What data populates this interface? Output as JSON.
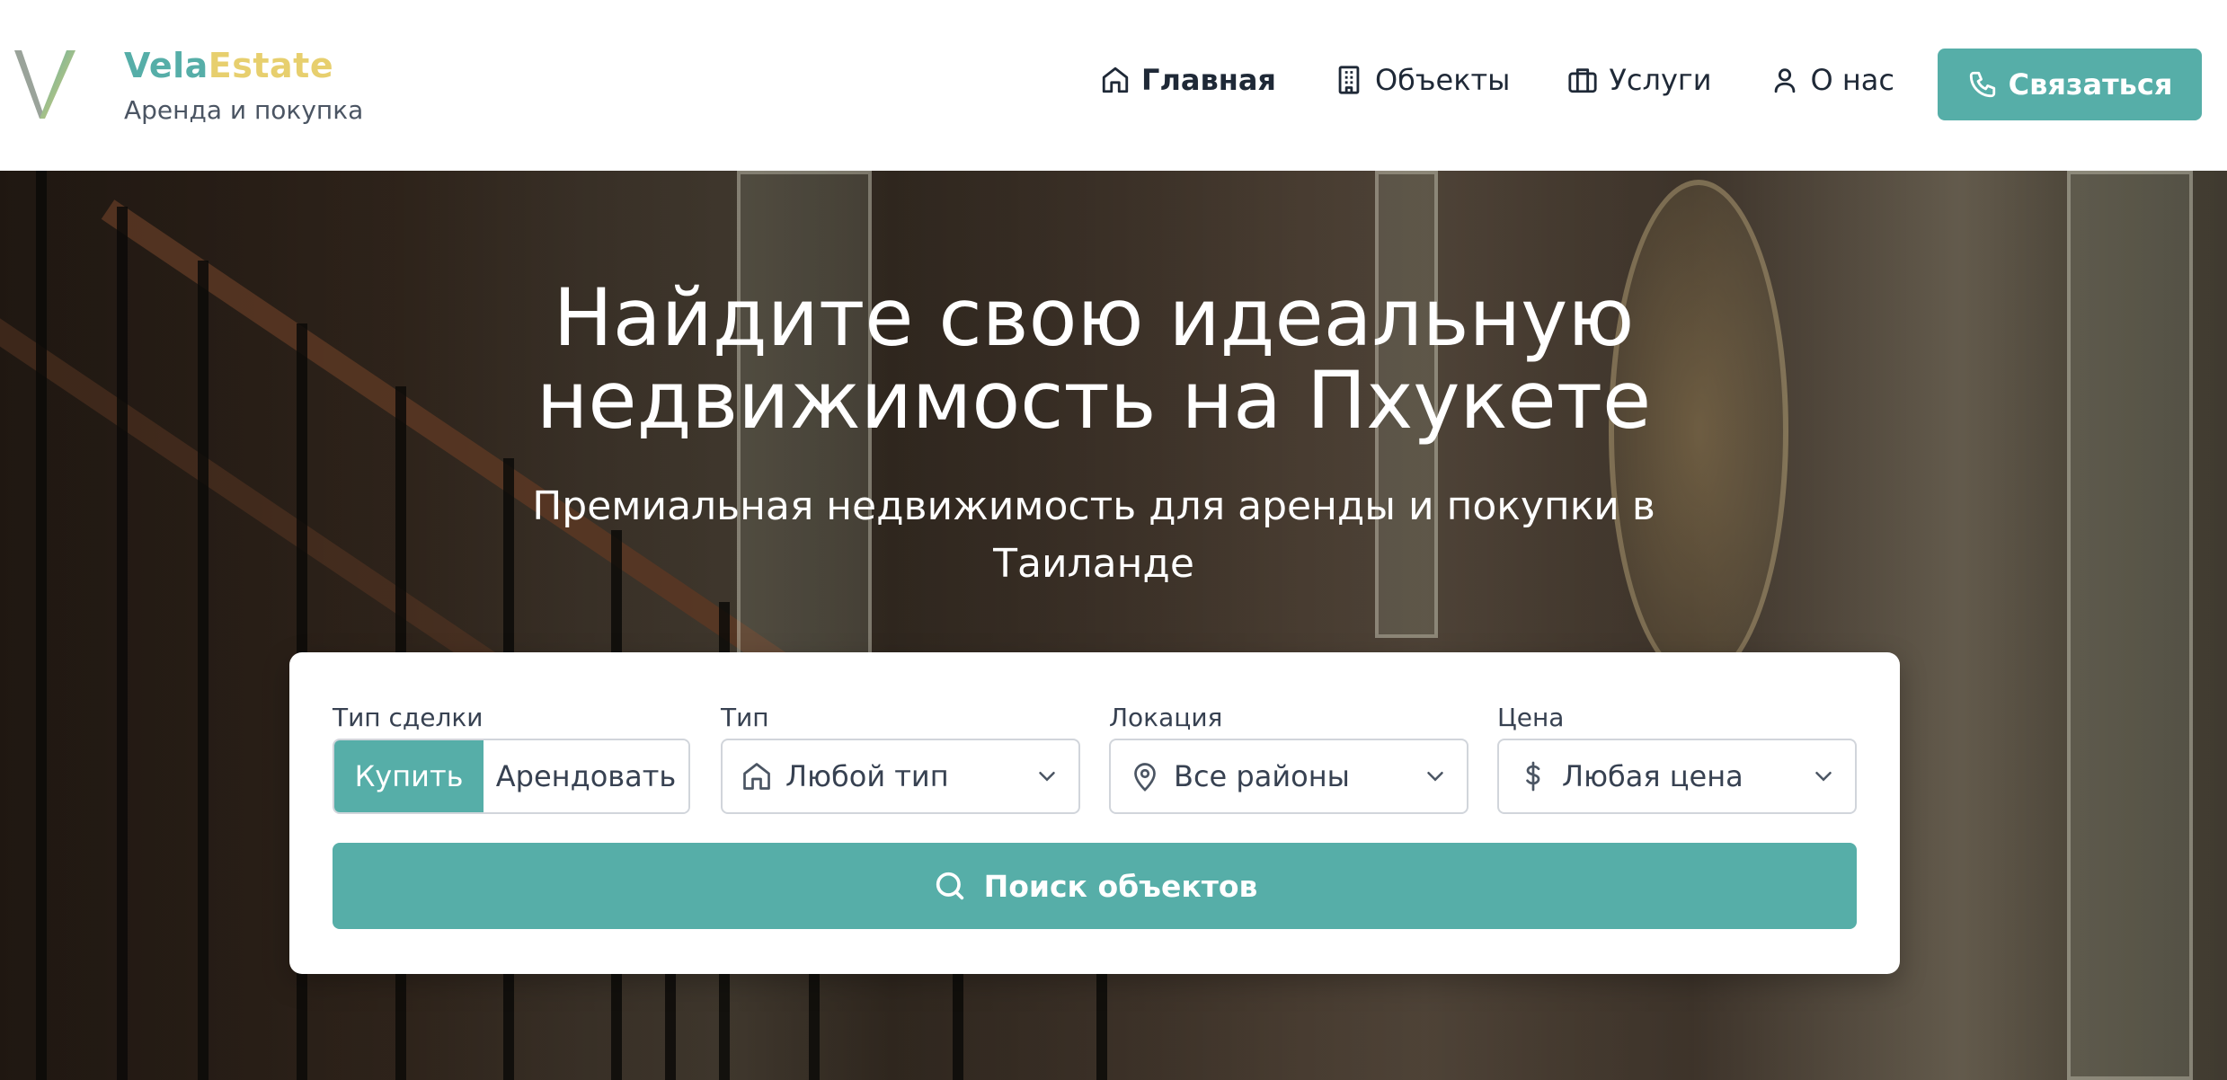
{
  "brand": {
    "name_part1": "Vela",
    "name_part2": "Estate",
    "tagline": "Аренда и покупка",
    "logo_icon": "v-logo-icon"
  },
  "nav": {
    "items": [
      {
        "label": "Главная",
        "icon": "home-icon",
        "active": true
      },
      {
        "label": "Объекты",
        "icon": "building-icon",
        "active": false
      },
      {
        "label": "Услуги",
        "icon": "briefcase-icon",
        "active": false
      },
      {
        "label": "О нас",
        "icon": "user-icon",
        "active": false
      }
    ],
    "contact_label": "Связаться",
    "contact_icon": "phone-icon"
  },
  "hero": {
    "title_line1": "Найдите свою идеальную",
    "title_line2": "недвижимость на Пхукете",
    "subtitle_line1": "Премиальная недвижимость для аренды и покупки в",
    "subtitle_line2": "Таиланде"
  },
  "search": {
    "deal_label": "Тип сделки",
    "deal_options": [
      "Купить",
      "Арендовать"
    ],
    "deal_selected": "Купить",
    "type_label": "Тип",
    "type_value": "Любой тип",
    "type_icon": "home-icon",
    "location_label": "Локация",
    "location_value": "Все районы",
    "location_icon": "map-pin-icon",
    "price_label": "Цена",
    "price_value": "Любая цена",
    "price_icon": "dollar-icon",
    "submit_label": "Поиск объектов",
    "submit_icon": "search-icon"
  },
  "colors": {
    "accent": "#56aea8",
    "brand_gold": "#e7cf6e",
    "text_dark": "#1f2937"
  }
}
